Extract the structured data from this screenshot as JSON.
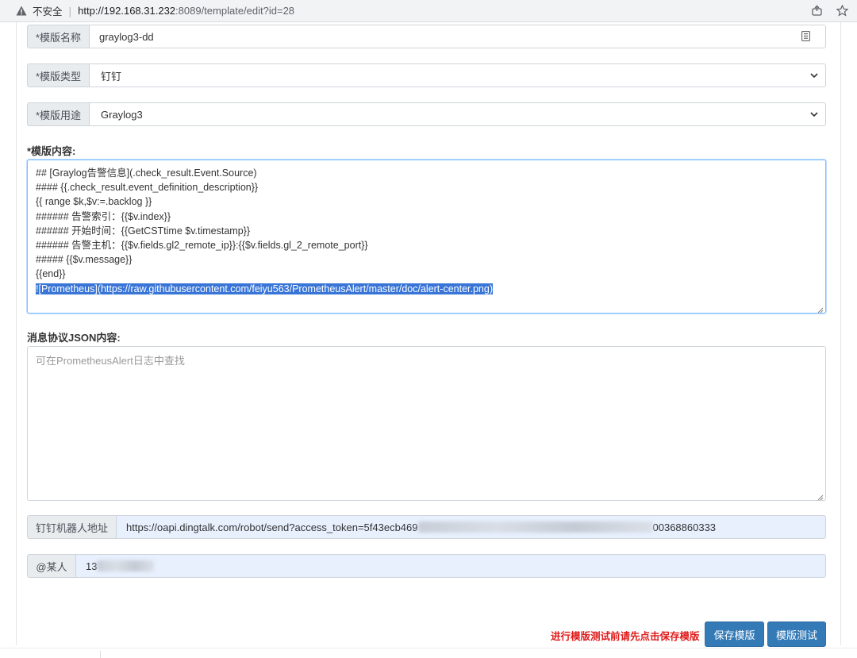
{
  "browser": {
    "insecure_label": "不安全",
    "url_host": "http://192.168.31.232",
    "url_rest": ":8089/template/edit?id=28"
  },
  "form": {
    "template_name": {
      "label": "*模版名称",
      "value": "graylog3-dd"
    },
    "template_type": {
      "label": "*模版类型",
      "value": "钉钉"
    },
    "template_usage": {
      "label": "*模版用途",
      "value": "Graylog3"
    },
    "content_label": "*模版内容:",
    "content_lines": [
      "## [Graylog告警信息](.check_result.Event.Source)",
      "#### {{.check_result.event_definition_description}}",
      "{{ range $k,$v:=.backlog }}",
      "###### 告警索引：{{$v.index}}",
      "###### 开始时间：{{GetCSTtime $v.timestamp}}",
      "###### 告警主机：{{$v.fields.gl2_remote_ip}}:{{$v.fields.gl_2_remote_port}}",
      "##### {{$v.message}}",
      "{{end}}"
    ],
    "content_selected_line": "![Prometheus](https://raw.githubusercontent.com/feiyu563/PrometheusAlert/master/doc/alert-center.png)",
    "json_label": "消息协议JSON内容:",
    "json_placeholder": "可在PrometheusAlert日志中查找",
    "robot_url": {
      "label": "钉钉机器人地址",
      "value_start": "https://oapi.dingtalk.com/robot/send?access_token=5f43ecb469",
      "value_end": "00368860333"
    },
    "at_person": {
      "label": "@某人",
      "value_start": "13"
    }
  },
  "footer": {
    "hint": "进行模版测试前请先点击保存模版",
    "save_button": "保存模版",
    "test_button": "模版测试"
  }
}
